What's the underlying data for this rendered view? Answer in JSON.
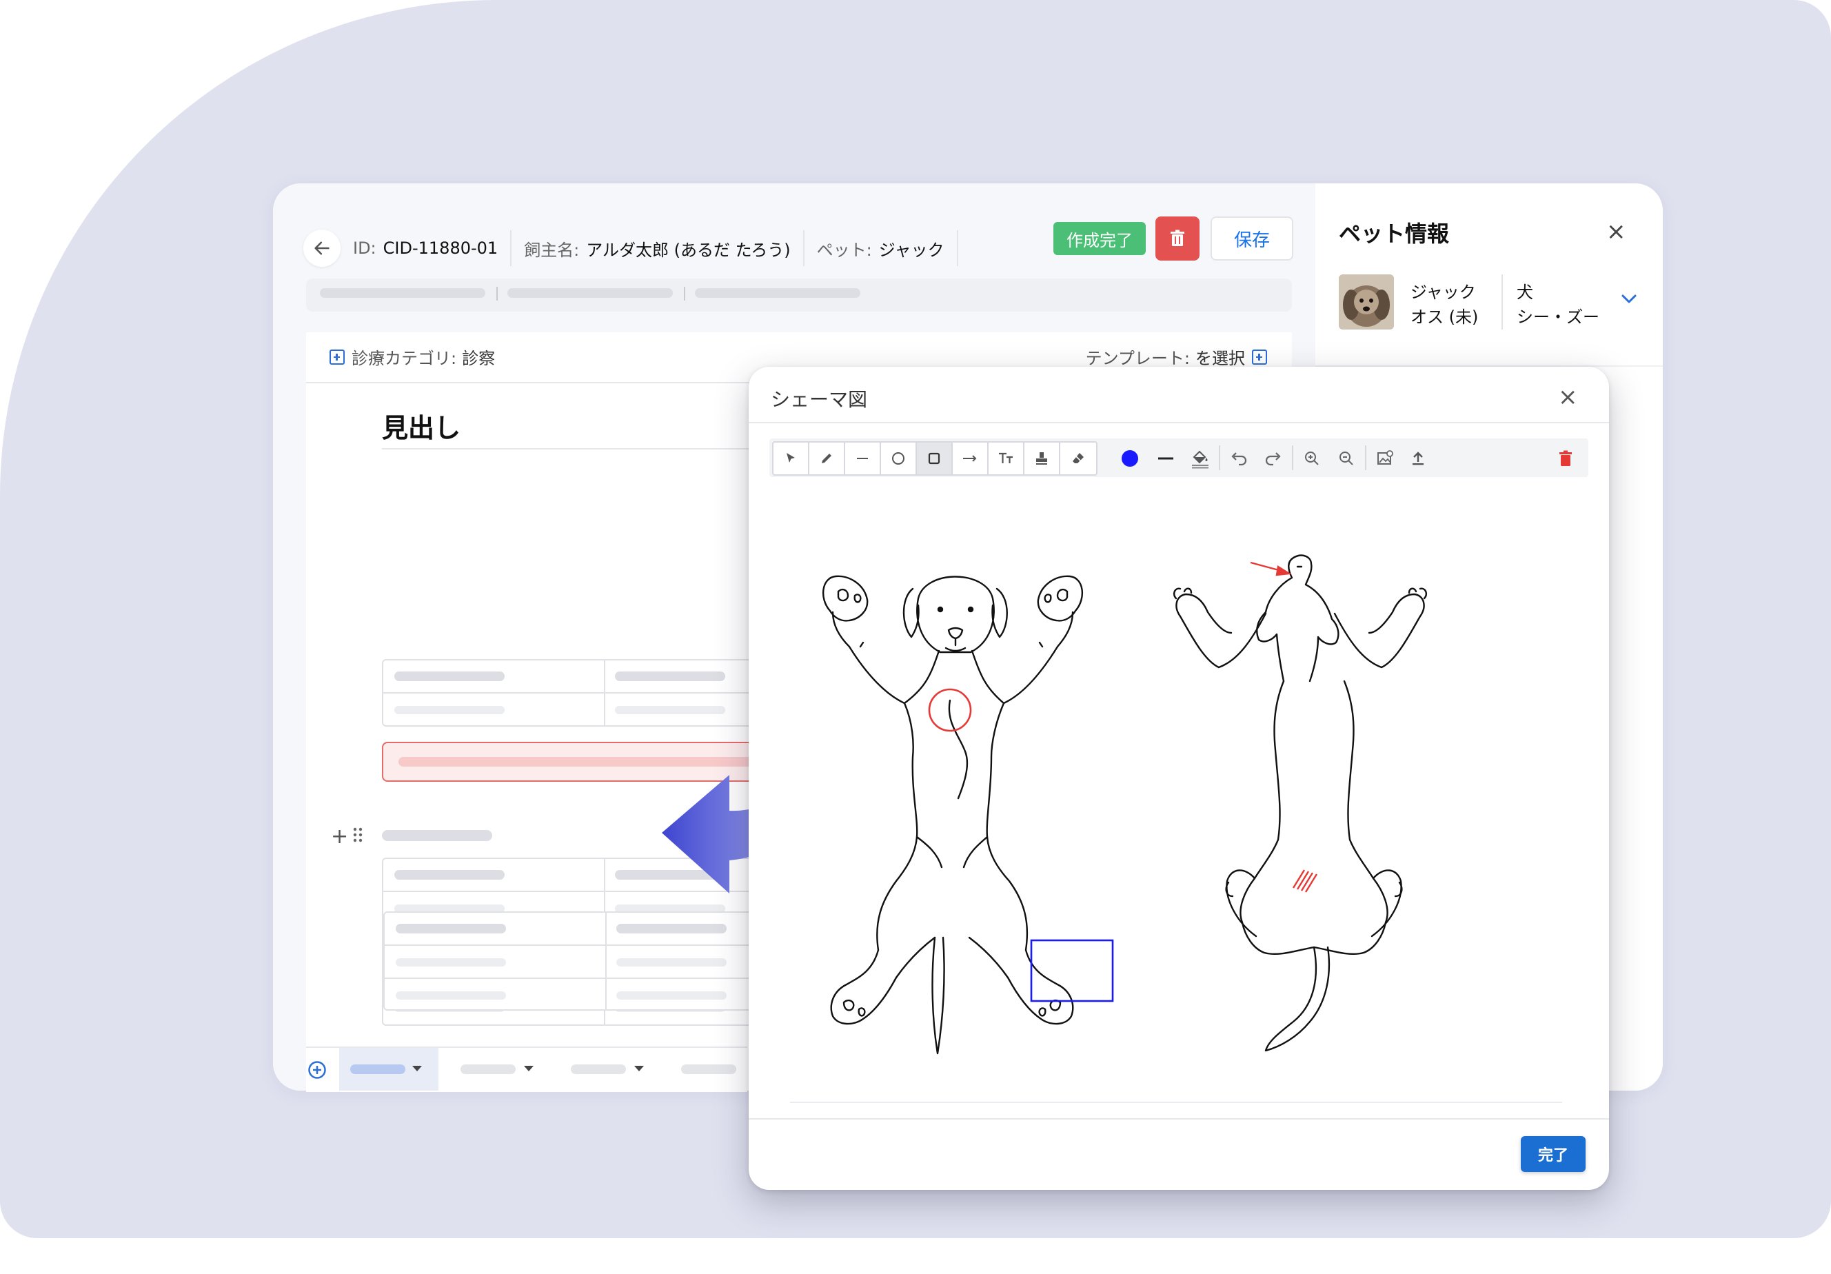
{
  "record": {
    "id_label": "ID:",
    "id_value": "CID-11880-01",
    "owner_label": "飼主名:",
    "owner_value": "アルダ太郎 (あるだ たろう)",
    "pet_label": "ペット:",
    "pet_value": "ジャック"
  },
  "actions": {
    "done_label": "作成完了",
    "save_label": "保存"
  },
  "content": {
    "category_label": "診療カテゴリ:",
    "category_value": "診察",
    "template_label": "テンプレート:",
    "template_value": "を選択",
    "heading": "見出し"
  },
  "side_panel": {
    "title": "ペット情報",
    "close_symbol": "×",
    "pet_name": "ジャック",
    "pet_sex": "オス (未)",
    "species": "犬",
    "breed": "シー・ズー"
  },
  "schema_dialog": {
    "title": "シェーマ図",
    "close_symbol": "×",
    "complete_label": "完了",
    "toolbar": {
      "tools": [
        "select-arrow-icon",
        "pencil-icon",
        "line-icon",
        "circle-icon",
        "rectangle-icon",
        "arrow-line-icon",
        "text-icon",
        "stamp-icon",
        "eraser-icon"
      ],
      "active_tool": "rectangle-icon",
      "current_color": "#1a1aff",
      "other_icons": [
        "stroke-width-icon",
        "fill-icon",
        "undo-icon",
        "redo-icon",
        "zoom-in-icon",
        "zoom-out-icon",
        "background-image-icon",
        "upload-icon",
        "delete-icon"
      ]
    },
    "annotations": [
      {
        "type": "circle",
        "color": "#e53935"
      },
      {
        "type": "rectangle",
        "color": "#1a1aff"
      },
      {
        "type": "arrow",
        "color": "#e53935"
      },
      {
        "type": "hatch",
        "color": "#e53935"
      }
    ]
  },
  "colors": {
    "background": "#dfe1ef",
    "accent_blue": "#1b6fd3",
    "success_green": "#4bbf76",
    "danger_red": "#e45151"
  }
}
